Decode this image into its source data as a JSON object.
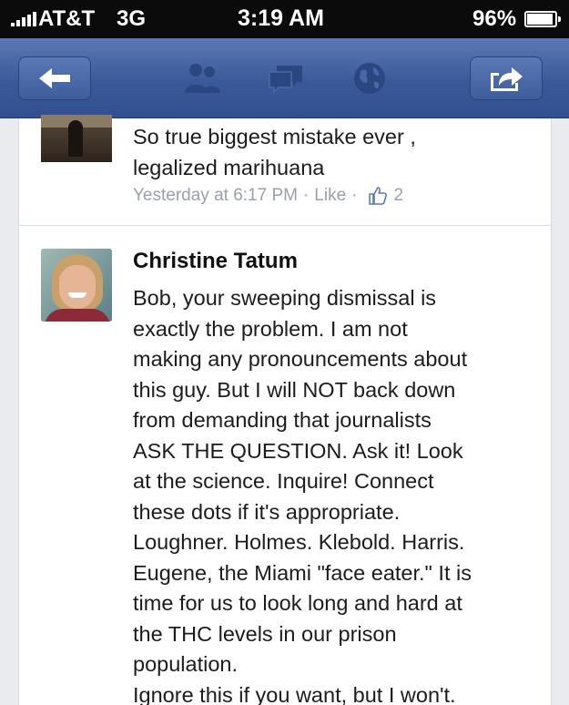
{
  "status_bar": {
    "carrier": "AT&T",
    "network": "3G",
    "time": "3:19 AM",
    "battery": "96%"
  },
  "nav_bar": {
    "left_icon": "back-arrow-icon",
    "center_icons": [
      "friends-icon",
      "messages-icon",
      "globe-icon"
    ],
    "right_icon": "share-icon",
    "bar_color": "#3b5998"
  },
  "comments": [
    {
      "text": "So true biggest mistake ever ,\nlegalized marihuana",
      "timestamp": "Yesterday at 6:17 PM",
      "separator": "·",
      "like_label": "Like",
      "like_count": "2"
    },
    {
      "author": "Christine Tatum",
      "text": "Bob, your sweeping dismissal is\nexactly the problem. I am not\nmaking any pronouncements about\nthis guy. But I will NOT back down\nfrom demanding that journalists\nASK THE QUESTION. Ask it! Look\nat the science. Inquire! Connect\nthese dots if it's appropriate.\nLoughner. Holmes. Klebold. Harris.\nEugene, the Miami \"face eater.\" It is\ntime for us to look long and hard at\nthe THC levels in our prison\npopulation.\nIgnore this if you want, but I won't."
    }
  ]
}
